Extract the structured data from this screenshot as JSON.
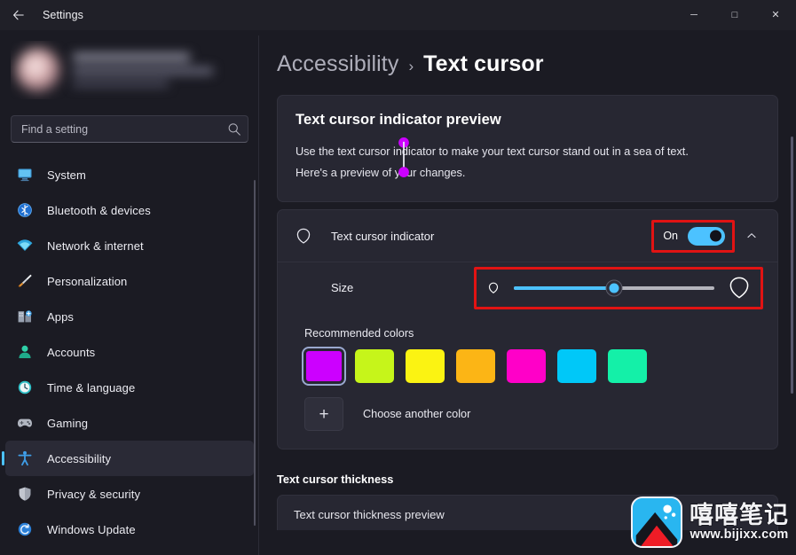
{
  "window": {
    "app_title": "Settings",
    "back_icon": "back-arrow-icon",
    "controls": {
      "minimize": "─",
      "maximize": "□",
      "close": "✕"
    }
  },
  "sidebar": {
    "account": {
      "blurred": true,
      "avatar_icon": "user-avatar"
    },
    "search": {
      "placeholder": "Find a setting",
      "value": "",
      "icon": "search-icon"
    },
    "items": [
      {
        "label": "System",
        "icon": "monitor-icon",
        "color": "#4aa3e0",
        "active": false
      },
      {
        "label": "Bluetooth & devices",
        "icon": "bluetooth-icon",
        "color": "#2a7fe0",
        "active": false
      },
      {
        "label": "Network & internet",
        "icon": "wifi-icon",
        "color": "#35b8e8",
        "active": false
      },
      {
        "label": "Personalization",
        "icon": "paintbrush-icon",
        "color": "#d08a3c",
        "active": false
      },
      {
        "label": "Apps",
        "icon": "apps-grid-icon",
        "color": "#8b93a6",
        "active": false
      },
      {
        "label": "Accounts",
        "icon": "person-accounts-icon",
        "color": "#2fbf9a",
        "active": false
      },
      {
        "label": "Time & language",
        "icon": "clock-icon",
        "color": "#39b7c4",
        "active": false
      },
      {
        "label": "Gaming",
        "icon": "gamepad-icon",
        "color": "#a9adb8",
        "active": false
      },
      {
        "label": "Accessibility",
        "icon": "accessibility-person-icon",
        "color": "#3a9ee8",
        "active": true
      },
      {
        "label": "Privacy & security",
        "icon": "shield-icon",
        "color": "#b9bcc6",
        "active": false
      },
      {
        "label": "Windows Update",
        "icon": "update-refresh-icon",
        "color": "#2f8fe0",
        "active": false
      }
    ]
  },
  "main": {
    "breadcrumb": {
      "parent": "Accessibility",
      "separator": "›",
      "current": "Text cursor"
    },
    "preview_card": {
      "title": "Text cursor indicator preview",
      "body": "Use the text cursor indicator to make your text cursor stand out in a sea of text. Here's a preview of your changes.",
      "indicator_color": "#cc00ff"
    },
    "indicator_row": {
      "label": "Text cursor indicator",
      "icon": "text-cursor-indicator-icon",
      "toggle_state": "On",
      "toggle_on": true,
      "expand_icon": "chevron-up-icon",
      "highlight_color": "#e11313"
    },
    "size_row": {
      "label": "Size",
      "small_icon": "cursor-indicator-small-icon",
      "large_icon": "cursor-indicator-large-icon",
      "slider_value": 50,
      "slider_min": 0,
      "slider_max": 100,
      "highlight_color": "#e11313"
    },
    "colors": {
      "title": "Recommended colors",
      "swatches": [
        {
          "name": "magenta-purple",
          "hex": "#cc00ff",
          "selected": true
        },
        {
          "name": "chartreuse",
          "hex": "#c6f51a",
          "selected": false
        },
        {
          "name": "yellow",
          "hex": "#fbf312",
          "selected": false
        },
        {
          "name": "amber",
          "hex": "#fcb515",
          "selected": false
        },
        {
          "name": "pink-magenta",
          "hex": "#ff00c8",
          "selected": false
        },
        {
          "name": "cyan",
          "hex": "#00c8f8",
          "selected": false
        },
        {
          "name": "spring-green",
          "hex": "#14f0a8",
          "selected": false
        }
      ],
      "another_color_label": "Choose another color",
      "plus_glyph": "+"
    },
    "thickness_section": {
      "header": "Text cursor thickness",
      "stub_text": "Text cursor thickness preview"
    }
  },
  "watermark": {
    "cn_text": "嘻嘻笔记",
    "url_text": "www.bijixx.com",
    "icon": "mountain-photo-icon"
  }
}
